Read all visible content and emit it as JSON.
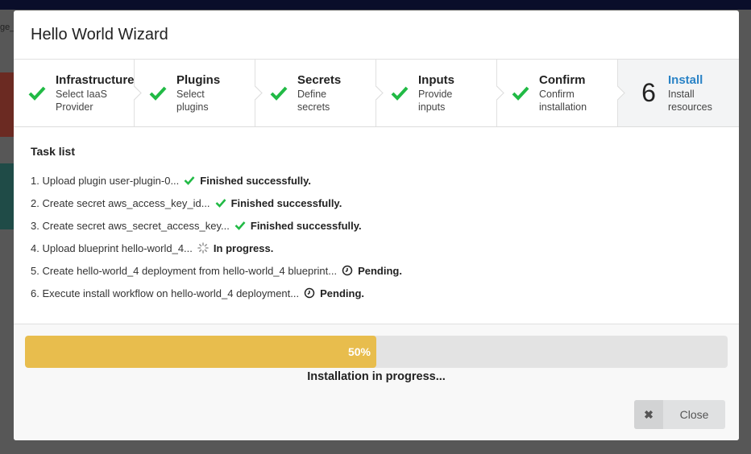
{
  "background": {
    "tab_fragment": "ge_"
  },
  "modal": {
    "title": "Hello World Wizard",
    "steps": [
      {
        "title": "Infrastructure",
        "desc1": "Select IaaS",
        "desc2": "Provider",
        "state": "done"
      },
      {
        "title": "Plugins",
        "desc1": "Select",
        "desc2": "plugins",
        "state": "done"
      },
      {
        "title": "Secrets",
        "desc1": "Define",
        "desc2": "secrets",
        "state": "done"
      },
      {
        "title": "Inputs",
        "desc1": "Provide",
        "desc2": "inputs",
        "state": "done"
      },
      {
        "title": "Confirm",
        "desc1": "Confirm",
        "desc2": "installation",
        "state": "done"
      },
      {
        "number": "6",
        "title": "Install",
        "desc1": "Install",
        "desc2": "resources",
        "state": "active"
      }
    ],
    "task_list_title": "Task list",
    "tasks": [
      {
        "text": "1. Upload plugin user-plugin-0...",
        "icon": "check-icon",
        "status": "Finished successfully."
      },
      {
        "text": "2. Create secret aws_access_key_id...",
        "icon": "check-icon",
        "status": "Finished successfully."
      },
      {
        "text": "3. Create secret aws_secret_access_key...",
        "icon": "check-icon",
        "status": "Finished successfully."
      },
      {
        "text": "4. Upload blueprint hello-world_4...",
        "icon": "spinner-icon",
        "status": "In progress."
      },
      {
        "text": "5. Create hello-world_4 deployment from hello-world_4 blueprint...",
        "icon": "clock-icon",
        "status": "Pending."
      },
      {
        "text": "6. Execute install workflow on hello-world_4 deployment...",
        "icon": "clock-icon",
        "status": "Pending."
      }
    ],
    "progress": {
      "percent": 50,
      "label": "50%",
      "text": "Installation in progress..."
    },
    "close_button": {
      "icon": "✖",
      "label": "Close"
    }
  },
  "colors": {
    "accent": "#2a83c6",
    "success": "#21ba45",
    "progress": "#e8bd4d"
  }
}
